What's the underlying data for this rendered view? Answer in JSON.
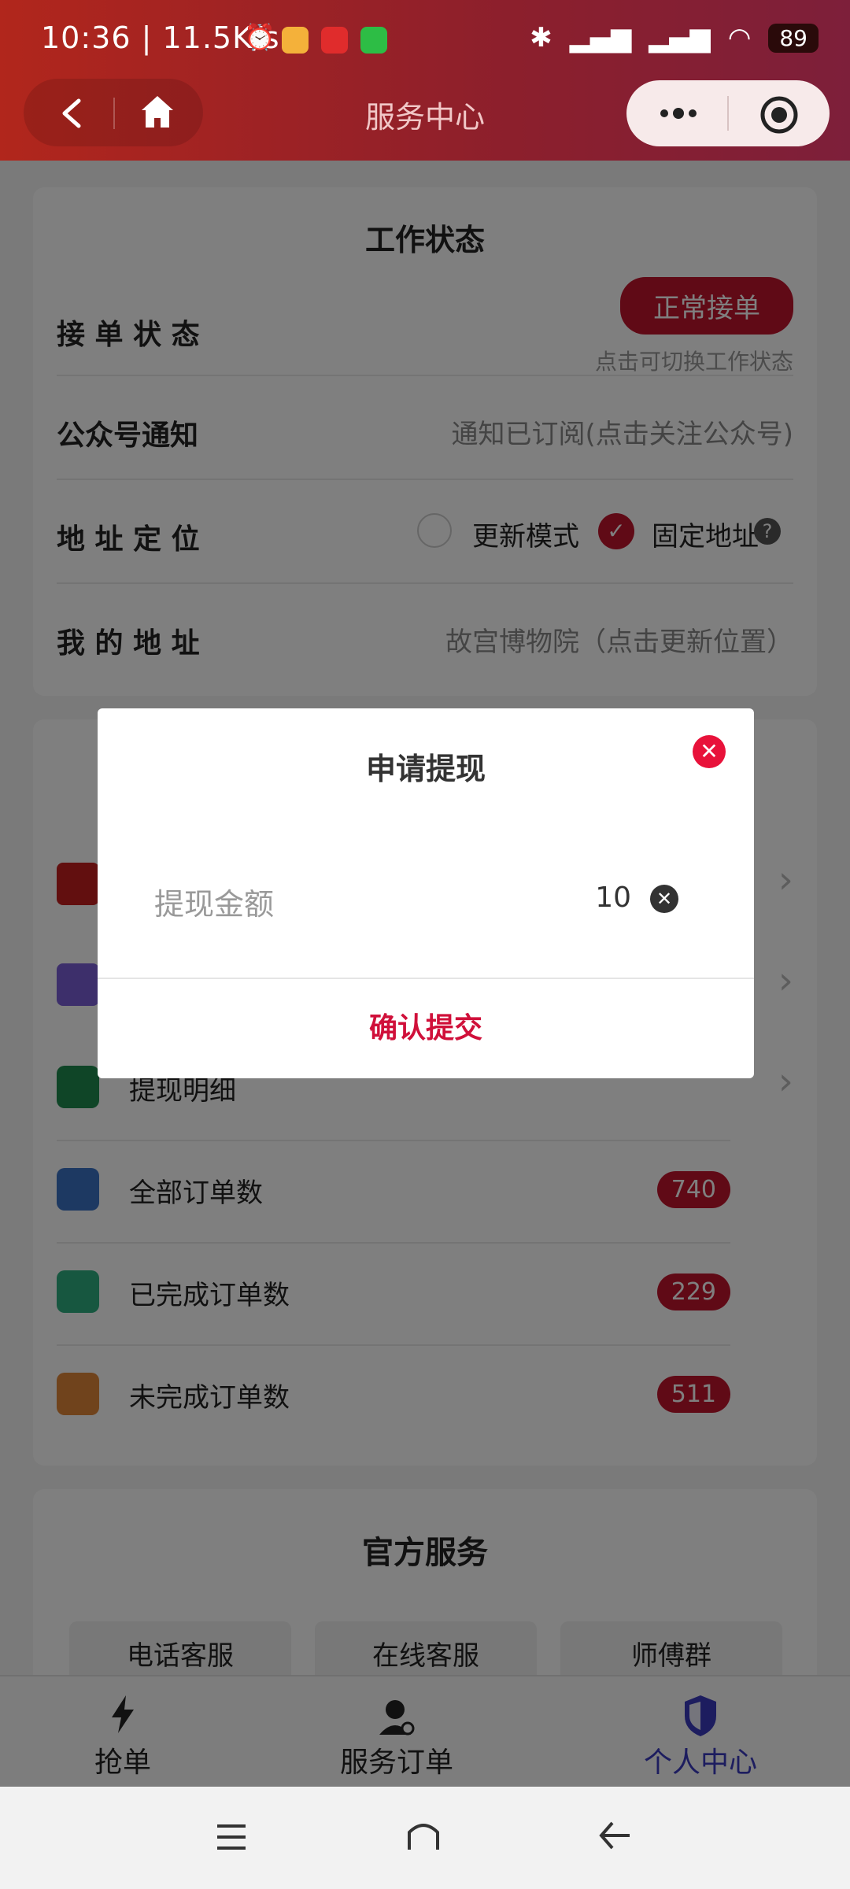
{
  "status_bar": {
    "time_speed": "10:36 | 11.5K/s",
    "battery": "89"
  },
  "header": {
    "title": "服务中心"
  },
  "work_status": {
    "title": "工作状态",
    "rows": {
      "order_status": {
        "label": "接 单 状 态",
        "button": "正常接单",
        "hint": "点击可切换工作状态"
      },
      "official_notice": {
        "label": "公众号通知",
        "value": "通知已订阅(点击关注公众号)"
      },
      "location": {
        "label": "地 址 定 位",
        "option_update": "更新模式",
        "option_fixed": "固定地址",
        "help": "?"
      },
      "my_address": {
        "label": "我 的 地 址",
        "value": "故宫博物院（点击更新位置）"
      }
    }
  },
  "account": {
    "items": [
      {
        "label": "提现明细",
        "color": "#1e8a4e"
      },
      {
        "label": "全部订单数",
        "count": "740",
        "color": "#3b72c4"
      },
      {
        "label": "已完成订单数",
        "count": "229",
        "color": "#2fae80"
      },
      {
        "label": "未完成订单数",
        "count": "511",
        "color": "#e08638"
      }
    ]
  },
  "official_service": {
    "title": "官方服务",
    "buttons": [
      "电话客服",
      "在线客服",
      "师傅群"
    ]
  },
  "tabbar": {
    "tabs": [
      {
        "label": "抢单"
      },
      {
        "label": "服务订单"
      },
      {
        "label": "个人中心"
      }
    ],
    "active_color": "#3b3bbf"
  },
  "modal": {
    "title": "申请提现",
    "field_label": "提现金额",
    "field_value": "10",
    "submit": "确认提交"
  },
  "colors": {
    "accent": "#c0142c",
    "header_start": "#b1261c",
    "header_end": "#7d1f3a"
  }
}
